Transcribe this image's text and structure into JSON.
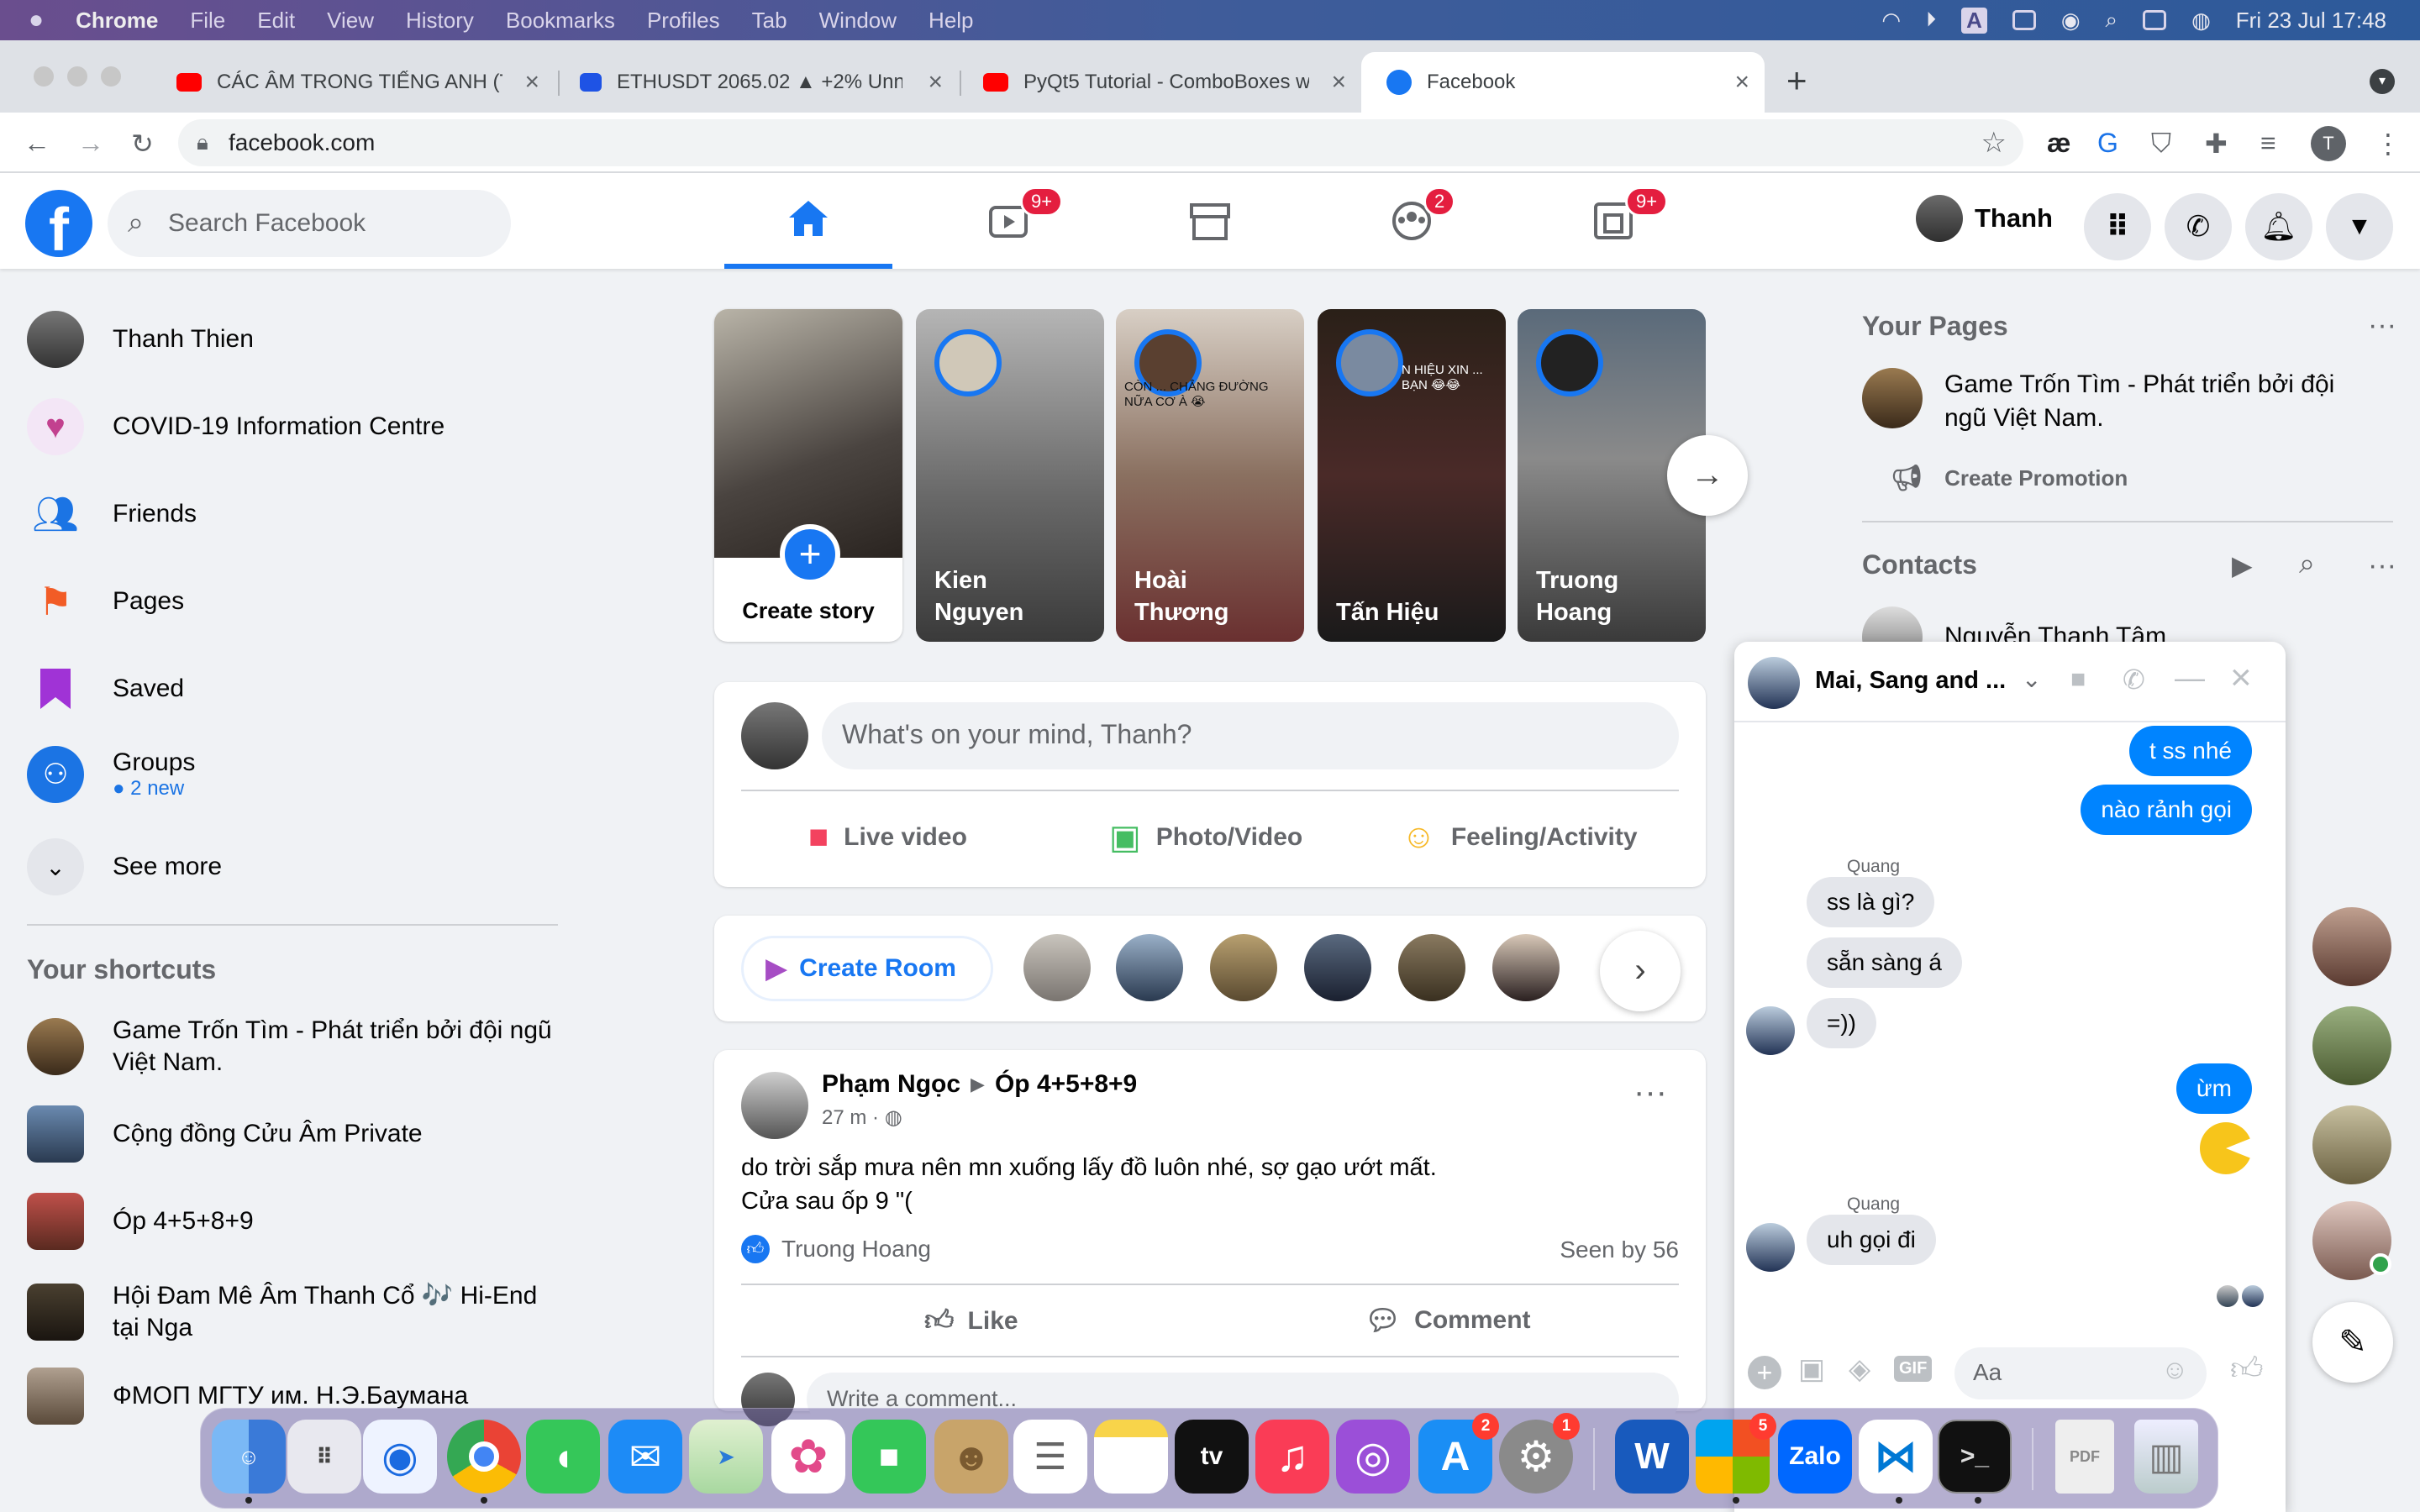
{
  "menubar": {
    "app": "Chrome",
    "menus": [
      "File",
      "Edit",
      "View",
      "History",
      "Bookmarks",
      "Profiles",
      "Tab",
      "Window",
      "Help"
    ],
    "input_badge": "A",
    "datetime": "Fri 23 Jul  17:48"
  },
  "tabs": [
    {
      "title": "CÁC ÂM TRONG TIẾNG ANH (T",
      "favicon": "youtube-icon",
      "color": "#ff0000"
    },
    {
      "title": "ETHUSDT 2065.02 ▲ +2% Unn",
      "favicon": "tradingview-icon",
      "color": "#1e53e5"
    },
    {
      "title": "PyQt5 Tutorial - ComboBoxes w",
      "favicon": "youtube-icon",
      "color": "#ff0000"
    },
    {
      "title": "Facebook",
      "favicon": "facebook-icon",
      "color": "#1877f2"
    }
  ],
  "toolbar": {
    "url": "facebook.com",
    "profile_initial": "T"
  },
  "fb": {
    "search_placeholder": "Search Facebook",
    "user_name": "Thanh",
    "badges": {
      "watch": "9+",
      "groups": "2",
      "gaming": "9+"
    },
    "left": {
      "items": [
        {
          "label": "Thanh Thien"
        },
        {
          "label": "COVID-19 Information Centre"
        },
        {
          "label": "Friends"
        },
        {
          "label": "Pages"
        },
        {
          "label": "Saved"
        },
        {
          "label": "Groups",
          "sub": "2 new"
        },
        {
          "label": "See more"
        }
      ],
      "shortcuts_title": "Your shortcuts",
      "shortcuts": [
        {
          "label": "Game Trốn Tìm - Phát triển bởi đội ngũ Việt Nam."
        },
        {
          "label": "Cộng đồng Cửu Âm Private"
        },
        {
          "label": "Óp 4+5+8+9"
        },
        {
          "label": "Hội Đam Mê Âm Thanh Cổ 🎶 Hi-End tại Nga"
        },
        {
          "label": "ФМОП МГТУ им. Н.Э.Баумана"
        }
      ]
    },
    "stories": {
      "create_label": "Create story",
      "items": [
        {
          "name": "Kien Nguyen"
        },
        {
          "name": "Hoài Thương"
        },
        {
          "name": "Tấn Hiệu"
        },
        {
          "name": "Truong Hoang"
        }
      ],
      "overlay_text_1": "CÒN ... CHẲNG ĐƯỜNG NỮA CƠ À 😭",
      "overlay_text_2": "N HIỆU XIN ... BẠN 😂😂"
    },
    "composer": {
      "placeholder": "What's on your mind, Thanh?",
      "live": "Live video",
      "photo": "Photo/Video",
      "feeling": "Feeling/Activity"
    },
    "rooms": {
      "create": "Create Room"
    },
    "post": {
      "author": "Phạm Ngọc",
      "group": "Óp 4+5+8+9",
      "time": "27 m · ",
      "text_line1": "do trời sắp mưa nên mn xuống lấy đồ luôn nhé, sợ gạo ướt mất.",
      "text_line2": "Cửa sau ốp 9 \"(",
      "reactor": "Truong Hoang",
      "seen": "Seen by 56",
      "like": "Like",
      "comment": "Comment",
      "comment_placeholder": "Write a comment..."
    },
    "right": {
      "pages_title": "Your Pages",
      "page_name": "Game Trốn Tìm - Phát triển bởi đội ngũ Việt Nam.",
      "create_promotion": "Create Promotion",
      "contacts_title": "Contacts",
      "contact_first": "Nguyễn Thanh Tâm"
    },
    "chat": {
      "title": "Mai, Sang and ...",
      "messages": [
        {
          "from": "me",
          "text": "t ss nhé"
        },
        {
          "from": "me",
          "text": "nào rảnh gọi"
        },
        {
          "from": "label",
          "text": "Quang"
        },
        {
          "from": "them",
          "text": "ss là gì?"
        },
        {
          "from": "them",
          "text": "sẵn sàng á"
        },
        {
          "from": "them",
          "text": "=))"
        },
        {
          "from": "me",
          "text": "ừm"
        },
        {
          "from": "label",
          "text": "Quang"
        },
        {
          "from": "them",
          "text": "uh gọi đi"
        }
      ],
      "input_placeholder": "Aa",
      "gif": "GIF"
    }
  },
  "dock": {
    "apps": [
      "Finder",
      "Launchpad",
      "Safari",
      "Chrome",
      "Messages",
      "Mail",
      "Maps",
      "Photos",
      "FaceTime",
      "Contacts",
      "Reminders",
      "Notes",
      "TV",
      "Music",
      "Podcasts",
      "App Store",
      "System Preferences",
      "Word",
      "Microsoft",
      "Zalo",
      "VS Code",
      "Terminal",
      "PDF",
      "Trash"
    ],
    "tv_label": "tv",
    "zalo_label": "Zalo",
    "word_label": "W",
    "badges": {
      "appstore": "2",
      "sysprefs": "1",
      "microsoft": "5"
    }
  }
}
